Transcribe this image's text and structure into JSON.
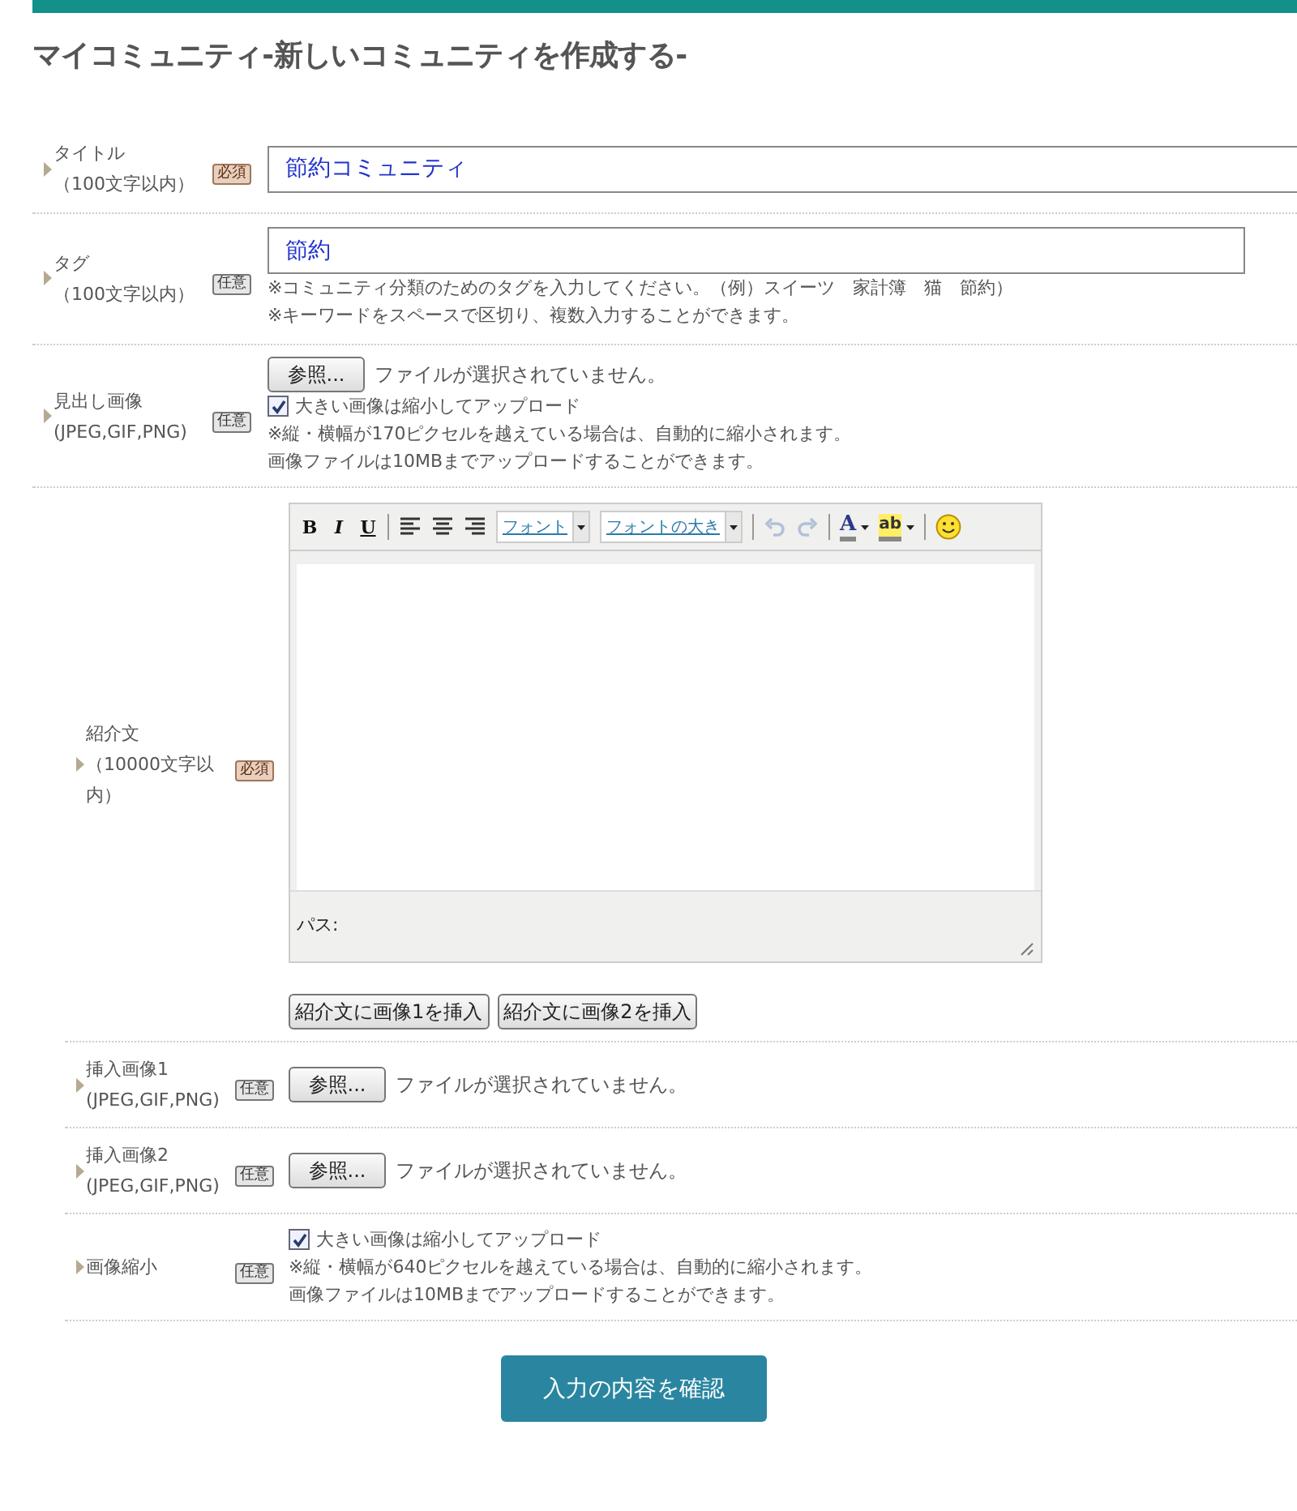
{
  "page_title": "マイコミュニティ-新しいコミュニティを作成する-",
  "sections": [
    {
      "rows": [
        {
          "label": "タイトル",
          "sublabel": "（100文字以内）",
          "badge": {
            "kind": "required",
            "text": "必須"
          },
          "content": [
            {
              "kind": "input",
              "value": "節約コミュニティ"
            }
          ]
        },
        {
          "label": "タグ",
          "sublabel": "（100文字以内）",
          "badge": {
            "kind": "optional",
            "text": "任意"
          },
          "content": [
            {
              "kind": "input",
              "value": "節約"
            },
            {
              "kind": "note",
              "text": "※コミュニティ分類のためのタグを入力してください。（例）スイーツ　家計簿　猫　節約）"
            },
            {
              "kind": "note",
              "text": "※キーワードをスペースで区切り、複数入力することができます。"
            }
          ]
        },
        {
          "label": "見出し画像",
          "sublabel": "(JPEG,GIF,PNG)",
          "badge": {
            "kind": "optional",
            "text": "任意"
          },
          "content": [
            {
              "kind": "file",
              "button": "参照...",
              "status": "ファイルが選択されていません。"
            },
            {
              "kind": "checkbox",
              "label": "大きい画像は縮小してアップロード",
              "checked": true
            },
            {
              "kind": "note",
              "text": "※縦・横幅が170ピクセルを越えている場合は、自動的に縮小されます。"
            },
            {
              "kind": "note",
              "text": "画像ファイルは10MBまでアップロードすることができます。"
            }
          ]
        }
      ]
    },
    {
      "rows": [
        {
          "label": "紹介文",
          "sublabel": "（10000文字以内）",
          "badge": {
            "kind": "required",
            "text": "必須"
          },
          "content": [
            {
              "kind": "editor",
              "toolbar": [
                [
                  {
                    "kind": "bold",
                    "text": "B",
                    "disabled": false
                  },
                  {
                    "kind": "italic",
                    "text": "I",
                    "disabled": false
                  },
                  {
                    "kind": "underline",
                    "text": "U",
                    "disabled": false
                  }
                ],
                [
                  {
                    "kind": "align-left",
                    "disabled": false
                  },
                  {
                    "kind": "align-center",
                    "disabled": false
                  },
                  {
                    "kind": "align-right",
                    "disabled": false
                  },
                  {
                    "kind": "select",
                    "text": "フォント",
                    "disabled": false
                  },
                  {
                    "kind": "select",
                    "text": "フォントの大き",
                    "disabled": false
                  }
                ],
                [
                  {
                    "kind": "undo",
                    "disabled": true
                  },
                  {
                    "kind": "redo",
                    "disabled": true
                  }
                ],
                [
                  {
                    "kind": "text-color",
                    "text": "A",
                    "disabled": false
                  },
                  {
                    "kind": "highlight",
                    "text": "ab",
                    "disabled": false
                  }
                ],
                [
                  {
                    "kind": "emoji",
                    "disabled": false
                  }
                ]
              ],
              "path": "パス:"
            },
            {
              "kind": "buttons",
              "items": [
                "紹介文に画像1を挿入",
                "紹介文に画像2を挿入"
              ]
            }
          ]
        },
        {
          "label": "挿入画像1",
          "sublabel": "(JPEG,GIF,PNG)",
          "badge": {
            "kind": "optional",
            "text": "任意"
          },
          "content": [
            {
              "kind": "file",
              "button": "参照...",
              "status": "ファイルが選択されていません。"
            }
          ]
        },
        {
          "label": "挿入画像2",
          "sublabel": "(JPEG,GIF,PNG)",
          "badge": {
            "kind": "optional",
            "text": "任意"
          },
          "content": [
            {
              "kind": "file",
              "button": "参照...",
              "status": "ファイルが選択されていません。"
            }
          ]
        },
        {
          "label": "画像縮小",
          "badge": {
            "kind": "optional",
            "text": "任意"
          },
          "content": [
            {
              "kind": "checkbox",
              "label": "大きい画像は縮小してアップロード",
              "checked": true
            },
            {
              "kind": "note",
              "text": "※縦・横幅が640ピクセルを越えている場合は、自動的に縮小されます。"
            },
            {
              "kind": "note",
              "text": "画像ファイルは10MBまでアップロードすることができます。"
            }
          ]
        }
      ]
    }
  ],
  "submit": "入力の内容を確認"
}
